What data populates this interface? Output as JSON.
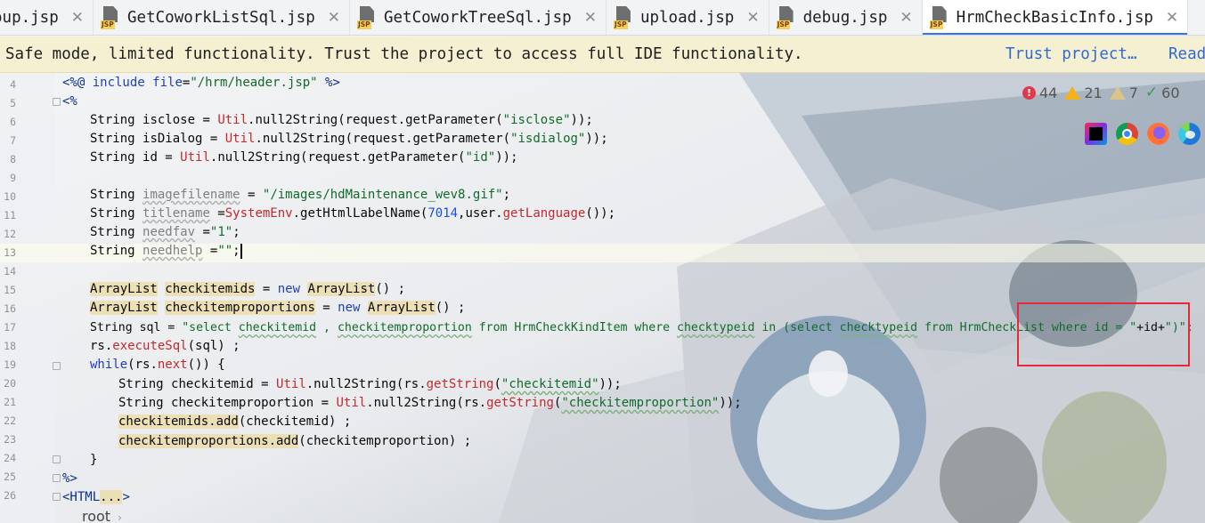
{
  "tabs": [
    {
      "label": "oup.jsp",
      "icon": "jsp-file-icon",
      "active": false
    },
    {
      "label": "GetCoworkListSql.jsp",
      "icon": "jsp-file-icon",
      "active": false
    },
    {
      "label": "GetCoworkTreeSql.jsp",
      "icon": "jsp-file-icon",
      "active": false
    },
    {
      "label": "upload.jsp",
      "icon": "jsp-file-icon",
      "active": false
    },
    {
      "label": "debug.jsp",
      "icon": "jsp-file-icon",
      "active": false
    },
    {
      "label": "HrmCheckBasicInfo.jsp",
      "icon": "jsp-file-icon",
      "active": true
    }
  ],
  "tab_icon_label": "JSP",
  "tab_close_glyph": "✕",
  "banner": {
    "message": "Safe mode, limited functionality. Trust the project to access full IDE functionality.",
    "trust_link": "Trust project…",
    "read_link": "Read"
  },
  "inspections": {
    "errors": "44",
    "warnings": "21",
    "weak_warnings": "7",
    "ok": "60"
  },
  "browsers": [
    "intellij-icon",
    "chrome-icon",
    "firefox-icon",
    "edge-icon"
  ],
  "editor": {
    "line_numbers": [
      "4",
      "5",
      "6",
      "7",
      "8",
      "9",
      "10",
      "11",
      "12",
      "13",
      "14",
      "15",
      "16",
      "17",
      "18",
      "19",
      "20",
      "21",
      "22",
      "23",
      "24",
      "25",
      "26"
    ],
    "lines": {
      "l4": {
        "a": "<%@ ",
        "b": "include ",
        "c": "file",
        "d": "=",
        "e": "\"/hrm/header.jsp\"",
        "f": " %>"
      },
      "l5": "<%",
      "l6": {
        "a": "String ",
        "b": "isclose",
        "c": " = ",
        "d": "Util",
        "e": ".null2String(",
        "f": "request",
        "g": ".getParameter(",
        "h": "\"isclose\"",
        "i": "));"
      },
      "l7": {
        "a": "String ",
        "b": "isDialog",
        "c": " = ",
        "d": "Util",
        "e": ".null2String(",
        "f": "request",
        "g": ".getParameter(",
        "h": "\"isdialog\"",
        "i": "));"
      },
      "l8": {
        "a": "String ",
        "b": "id",
        "c": " = ",
        "d": "Util",
        "e": ".null2String(",
        "f": "request",
        "g": ".getParameter(",
        "h": "\"id\"",
        "i": "));"
      },
      "l10": {
        "a": "String ",
        "b": "imagefilename",
        "c": " = ",
        "d": "\"/images/hdMaintenance_wev8.gif\"",
        "e": ";"
      },
      "l11": {
        "a": "String ",
        "b": "titlename",
        "c": " =",
        "d": "SystemEnv",
        "e": ".getHtmlLabelName(",
        "f": "7014",
        "g": ",user.",
        "h": "getLanguage",
        "i": "());"
      },
      "l12": {
        "a": "String ",
        "b": "needfav",
        "c": " =",
        "d": "\"1\"",
        "e": ";"
      },
      "l13": {
        "a": "String ",
        "b": "needhelp",
        "c": " =",
        "d": "\"\"",
        "e": ";"
      },
      "l15": {
        "a": "ArrayList",
        "b": " ",
        "c": "checkitemids",
        "d": " = ",
        "e": "new ",
        "f": "ArrayList",
        "g": "() ;"
      },
      "l16": {
        "a": "ArrayList",
        "b": " ",
        "c": "checkitemproportions",
        "d": " = ",
        "e": "new ",
        "f": "ArrayList",
        "g": "() ;"
      },
      "l17": {
        "a": "String ",
        "b": "sql",
        "c": " = ",
        "d": "\"select ",
        "e": "checkitemid",
        "f": " , ",
        "g": "checkitemproportion",
        "h": " from HrmCheckKindItem where ",
        "i": "checktypeid",
        "j": " in (select ",
        "k": "checktypeid",
        "l": " from HrmCheckList where id = \"",
        "m": "+id+",
        "n": "\")\"",
        "o": ";"
      },
      "l18": {
        "a": "rs",
        "b": ".",
        "c": "executeSql",
        "d": "(sql) ;"
      },
      "l19": {
        "a": "while",
        "b": "(rs.",
        "c": "next",
        "d": "()) {"
      },
      "l20": {
        "a": "String ",
        "b": "checkitemid",
        "c": " = ",
        "d": "Util",
        "e": ".null2String(",
        "f": "rs",
        "g": ".",
        "h": "getString",
        "i": "(",
        "j": "\"checkitemid\"",
        "k": "));"
      },
      "l21": {
        "a": "String ",
        "b": "checkitemproportion",
        "c": " = ",
        "d": "Util",
        "e": ".null2String(",
        "f": "rs",
        "g": ".",
        "h": "getString",
        "i": "(",
        "j": "\"checkitemproportion\"",
        "k": "));"
      },
      "l22": {
        "a": "checkitemids.add",
        "b": "(",
        "c": "checkitemid",
        "d": ") ;"
      },
      "l23": {
        "a": "checkitemproportions.add",
        "b": "(",
        "c": "checkitemproportion",
        "d": ") ;"
      },
      "l24": "}",
      "l25": "%>",
      "l26": {
        "a": "<HTML",
        "b": "...",
        "c": ">"
      }
    }
  },
  "breadcrumb": {
    "root": "root",
    "chevron": "›"
  },
  "colors": {
    "accent": "#3574f0",
    "highlight_box": "#e8283a",
    "keyword": "#1f3fbf",
    "string": "#116b2a",
    "error": "#db3b4b",
    "warning": "#f2b31a"
  }
}
